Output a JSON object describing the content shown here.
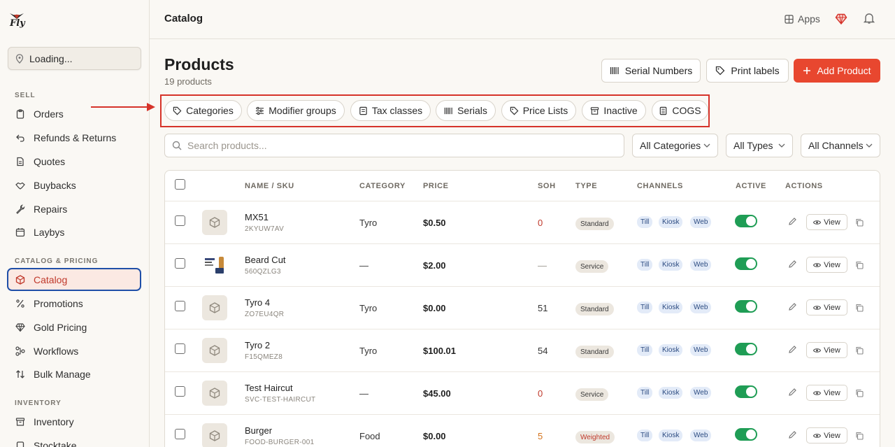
{
  "sidebar": {
    "logo_text": "Fly",
    "location": "Loading...",
    "sections": [
      {
        "title": "SELL",
        "items": [
          "Orders",
          "Refunds & Returns",
          "Quotes",
          "Buybacks",
          "Repairs",
          "Laybys"
        ]
      },
      {
        "title": "CATALOG & PRICING",
        "items": [
          "Catalog",
          "Promotions",
          "Gold Pricing",
          "Workflows",
          "Bulk Manage"
        ]
      },
      {
        "title": "INVENTORY",
        "items": [
          "Inventory",
          "Stocktake"
        ]
      }
    ]
  },
  "topbar": {
    "title": "Catalog",
    "apps_label": "Apps"
  },
  "page": {
    "title": "Products",
    "subtitle": "19 products",
    "buttons": {
      "serial_numbers": "Serial Numbers",
      "print_labels": "Print labels",
      "add_product": "Add Product"
    },
    "subnav": [
      "Categories",
      "Modifier groups",
      "Tax classes",
      "Serials",
      "Price Lists",
      "Inactive",
      "COGS"
    ],
    "search_placeholder": "Search products...",
    "filters": [
      "All Categories",
      "All Types",
      "All Channels"
    ]
  },
  "table": {
    "headers": [
      "NAME / SKU",
      "CATEGORY",
      "PRICE",
      "SOH",
      "TYPE",
      "CHANNELS",
      "ACTIVE",
      "ACTIONS"
    ],
    "view_label": "View",
    "rows": [
      {
        "name": "MX51",
        "sku": "2KYUW7AV",
        "category": "Tyro",
        "price": "$0.50",
        "soh": "0",
        "soh_color": "#c0392b",
        "type": "Standard",
        "channels": [
          "Till",
          "Kiosk",
          "Web"
        ],
        "image": false
      },
      {
        "name": "Beard Cut",
        "sku": "560QZLG3",
        "category": "—",
        "price": "$2.00",
        "soh": "—",
        "soh_color": "#9a958d",
        "type": "Service",
        "channels": [
          "Till",
          "Kiosk",
          "Web"
        ],
        "image": true
      },
      {
        "name": "Tyro 4",
        "sku": "ZO7EU4QR",
        "category": "Tyro",
        "price": "$0.00",
        "soh": "51",
        "soh_color": "#333333",
        "type": "Standard",
        "channels": [
          "Till",
          "Kiosk",
          "Web"
        ],
        "image": false
      },
      {
        "name": "Tyro 2",
        "sku": "F15QMEZ8",
        "category": "Tyro",
        "price": "$100.01",
        "soh": "54",
        "soh_color": "#333333",
        "type": "Standard",
        "channels": [
          "Till",
          "Kiosk",
          "Web"
        ],
        "image": false
      },
      {
        "name": "Test Haircut",
        "sku": "SVC-TEST-HAIRCUT",
        "category": "—",
        "price": "$45.00",
        "soh": "0",
        "soh_color": "#c0392b",
        "type": "Service",
        "channels": [
          "Till",
          "Kiosk",
          "Web"
        ],
        "image": false
      },
      {
        "name": "Burger",
        "sku": "FOOD-BURGER-001",
        "category": "Food",
        "price": "$0.00",
        "soh": "5",
        "soh_color": "#d4731c",
        "type": "Weighted",
        "type_color": "#c0392b",
        "channels": [
          "Till",
          "Kiosk",
          "Web"
        ],
        "image": false
      }
    ]
  },
  "colors": {
    "accent": "#e8472f",
    "active_outline": "#1f4fa8",
    "toggle_on": "#1f9d55"
  }
}
